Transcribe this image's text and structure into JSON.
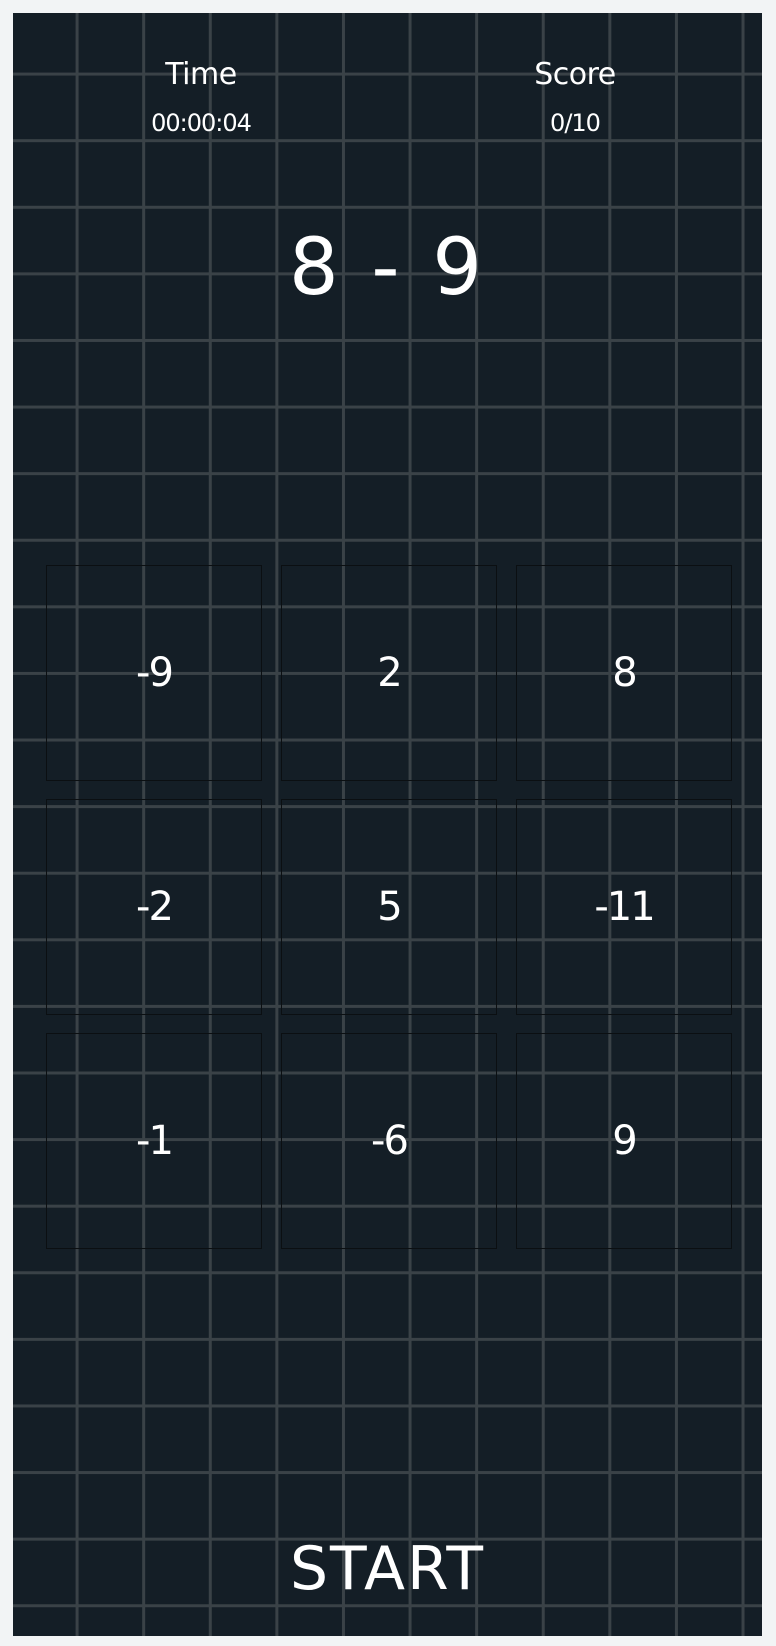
{
  "stats": {
    "time_label": "Time",
    "time_value": "00:00:04",
    "score_label": "Score",
    "score_value": "0/10"
  },
  "problem": "8 - 9",
  "answers": [
    "-9",
    "2",
    "8",
    "-2",
    "5",
    "-11",
    "-1",
    "-6",
    "9"
  ],
  "start_label": "START",
  "colors": {
    "background": "#141e26",
    "grid_lines": "#3a4247",
    "text": "#ffffff",
    "page": "#f2f4f5"
  }
}
